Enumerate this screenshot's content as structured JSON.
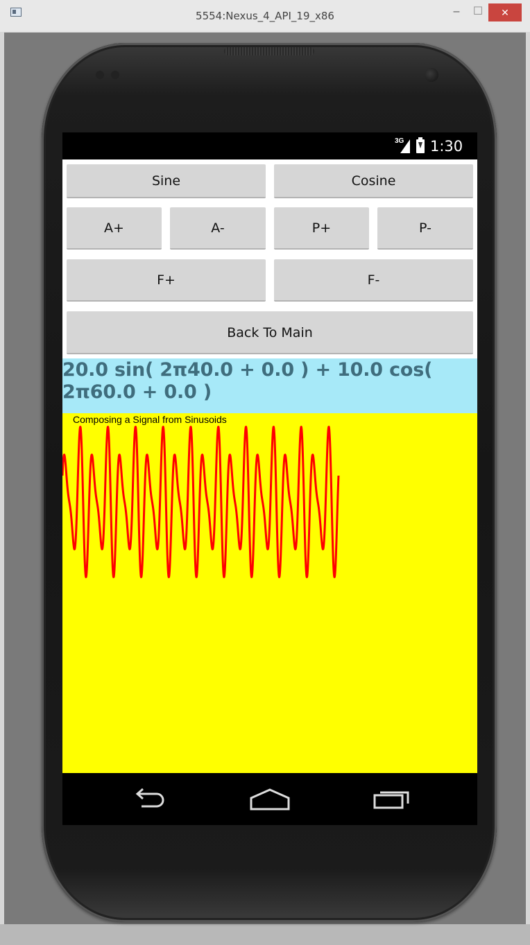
{
  "window": {
    "title": "5554:Nexus_4_API_19_x86",
    "minimize": "–",
    "maximize": "☐",
    "close": "✕"
  },
  "status_bar": {
    "network": "3G",
    "time": "1:30"
  },
  "buttons": {
    "sine": "Sine",
    "cosine": "Cosine",
    "amp_up": "A+",
    "amp_down": "A-",
    "phase_up": "P+",
    "phase_down": "P-",
    "freq_up": "F+",
    "freq_down": "F-",
    "back": "Back To Main"
  },
  "formula": "20.0 sin( 2π40.0 + 0.0 ) + 10.0 cos( 2π60.0 + 0.0 )",
  "plot": {
    "title": "Composing a Signal from Sinusoids",
    "background": "#ffff00",
    "line_color": "#ff0000"
  },
  "chart_data": {
    "type": "line",
    "title": "Composing a Signal from Sinusoids",
    "series": [
      {
        "components": [
          {
            "function": "sin",
            "amplitude": 20.0,
            "frequency": 40.0,
            "phase": 0.0
          },
          {
            "function": "cos",
            "amplitude": 10.0,
            "frequency": 60.0,
            "phase": 0.0
          }
        ]
      }
    ],
    "periods_shown": 10,
    "grid": false
  },
  "nav": {
    "back_icon": "back-arrow-icon",
    "home_icon": "home-icon",
    "recents_icon": "recent-apps-icon"
  }
}
